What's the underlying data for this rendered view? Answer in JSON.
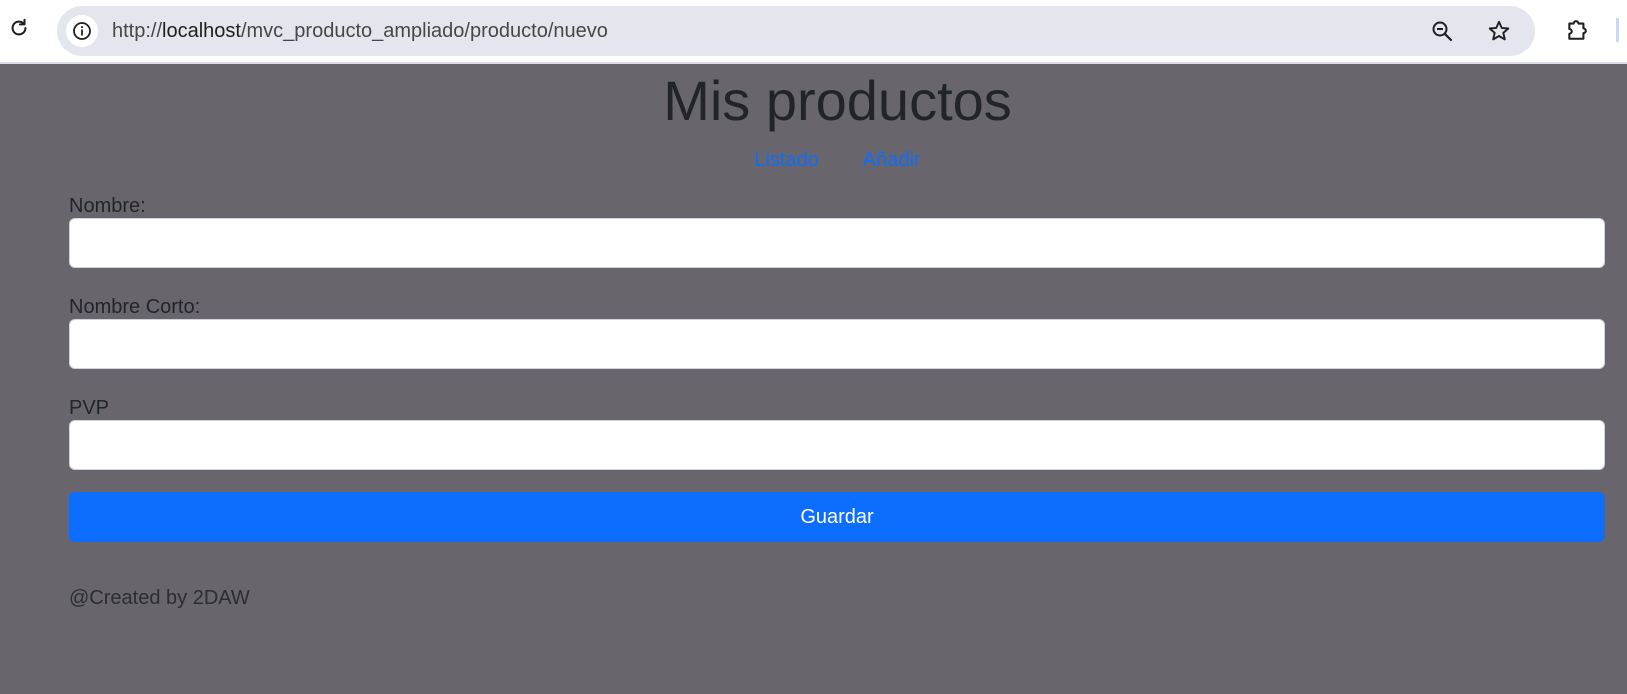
{
  "browser": {
    "url_prefix": "http://",
    "url_host": "localhost",
    "url_path": "/mvc_producto_ampliado/producto/nuevo",
    "icons": {
      "reload": "reload-icon",
      "site_info": "info-icon",
      "zoom": "zoom-out-icon",
      "bookmark": "star-icon",
      "extensions": "puzzle-icon"
    }
  },
  "page": {
    "title": "Mis productos",
    "background": "#68666c",
    "nav": [
      {
        "label": "Listado"
      },
      {
        "label": "Añadir"
      }
    ],
    "link_color": "#0d6efd"
  },
  "form": {
    "fields": [
      {
        "label": "Nombre:",
        "value": ""
      },
      {
        "label": "Nombre Corto:",
        "value": ""
      },
      {
        "label": "PVP",
        "value": ""
      }
    ],
    "submit_label": "Guardar",
    "submit_color": "#0d6efd"
  },
  "footer": {
    "text": "@Created by 2DAW"
  }
}
